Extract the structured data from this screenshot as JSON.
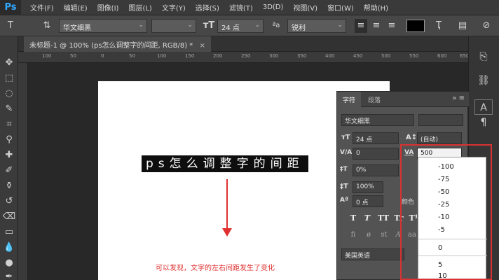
{
  "app": {
    "logo": "Ps"
  },
  "menubar": {
    "items": [
      "文件(F)",
      "编辑(E)",
      "图像(I)",
      "图层(L)",
      "文字(Y)",
      "选择(S)",
      "滤镜(T)",
      "3D(D)",
      "视图(V)",
      "窗口(W)",
      "帮助(H)"
    ]
  },
  "options": {
    "font_family": "华文细黑",
    "font_size": "24 点",
    "aa_label": "ªa",
    "antialias": "锐利",
    "color": "#000000"
  },
  "document": {
    "tab_label": "未标题-1 @ 100% (ps怎么调整字的间距, RGB/8) *",
    "close": "×"
  },
  "ruler": {
    "ticks": [
      "100",
      "50",
      "0",
      "50",
      "100",
      "150",
      "200",
      "250",
      "300",
      "350",
      "400",
      "450",
      "500",
      "550",
      "600",
      "650"
    ]
  },
  "canvas": {
    "text": "ps怎么调整字的间距",
    "note": "可以发现，文字的左右间距发生了变化"
  },
  "character_panel": {
    "tabs": [
      "字符",
      "段落"
    ],
    "font_family": "华文细黑",
    "font_size": "24 点",
    "leading": "(自动)",
    "kerning": "0",
    "tracking": "500",
    "vertical_scale": "0%",
    "horizontal_scale": "100%",
    "baseline_shift": "0 点",
    "color_label": "颜色",
    "language": "美国英语",
    "style_buttons": [
      "T",
      "T",
      "TT",
      "Tr",
      "T¹"
    ],
    "style_buttons2": [
      "fi",
      "ø",
      "st",
      "A",
      "aa"
    ]
  },
  "tracking_dropdown": {
    "options": [
      "-100",
      "-75",
      "-50",
      "-25",
      "-10",
      "-5",
      "0",
      "5",
      "10"
    ],
    "selected": "500"
  },
  "colors": {
    "annotation": "#e03030",
    "accent": "#31a8ff"
  }
}
